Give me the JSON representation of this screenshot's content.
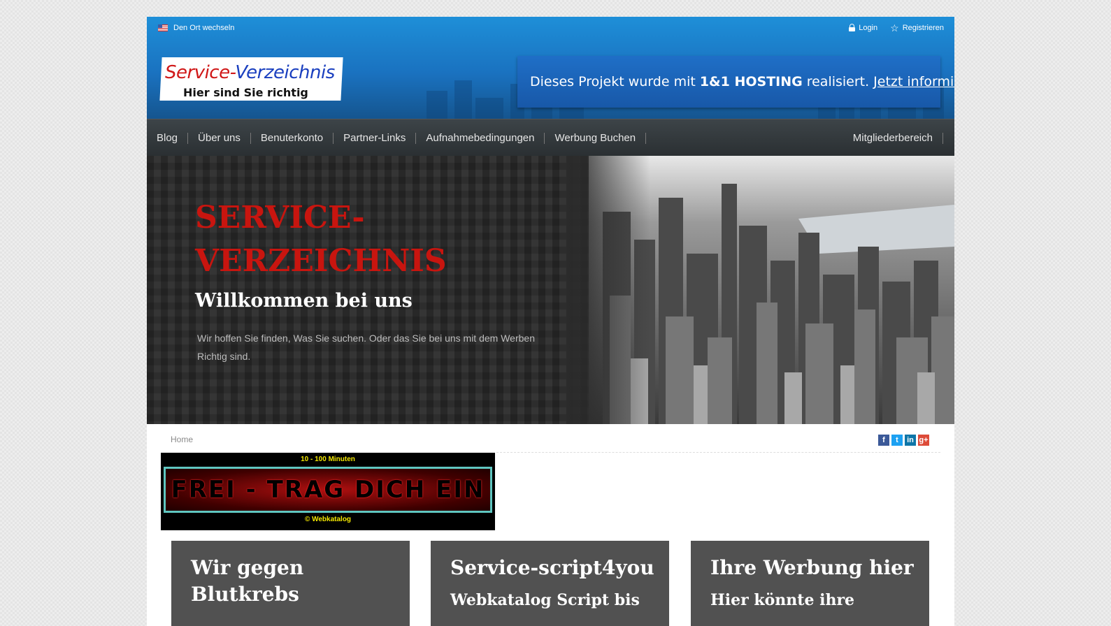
{
  "topbar": {
    "location_label": "Den Ort wechseln",
    "login_label": "Login",
    "register_label": "Registrieren"
  },
  "logo": {
    "title_part1": "Service-",
    "title_part2": "Verzeichnis",
    "subtitle": "Hier sind Sie richtig"
  },
  "ad_banner": {
    "text_before": "Dieses Projekt wurde mit",
    "brand": "1&1 HOSTING",
    "text_after": "realisiert.",
    "link": "Jetzt informieren!"
  },
  "nav": {
    "items": [
      "Blog",
      "Über uns",
      "Benuterkonto",
      "Partner-Links",
      "Aufnahmebedingungen",
      "Werbung Buchen"
    ],
    "right_item": "Mitgliederbereich"
  },
  "hero": {
    "title": "SERVICE-VERZEICHNIS",
    "subtitle": "Willkommen bei uns",
    "text": "Wir hoffen Sie finden, Was Sie suchen. Oder das Sie bei uns mit dem Werben Richtig sind."
  },
  "breadcrumb": {
    "home": "Home"
  },
  "social": {
    "icons": [
      "facebook-icon",
      "twitter-icon",
      "linkedin-icon",
      "google-plus-icon"
    ]
  },
  "promo": {
    "top_text": "10 - 100 Minuten",
    "main_text": "FREI - TRAG DICH EIN",
    "bottom_text": "© Webkatalog"
  },
  "cards": [
    {
      "title": "Wir gegen Blutkrebs",
      "subtitle": ""
    },
    {
      "title": "Service-script4you",
      "subtitle": "Webkatalog Script bis"
    },
    {
      "title": "Ihre Werbung hier",
      "subtitle": "Hier könnte ihre"
    }
  ],
  "colors": {
    "header_blue": "#1a72c0",
    "nav_dark": "#2a2f32",
    "hero_red": "#c8150f",
    "card_gray": "#515151"
  }
}
